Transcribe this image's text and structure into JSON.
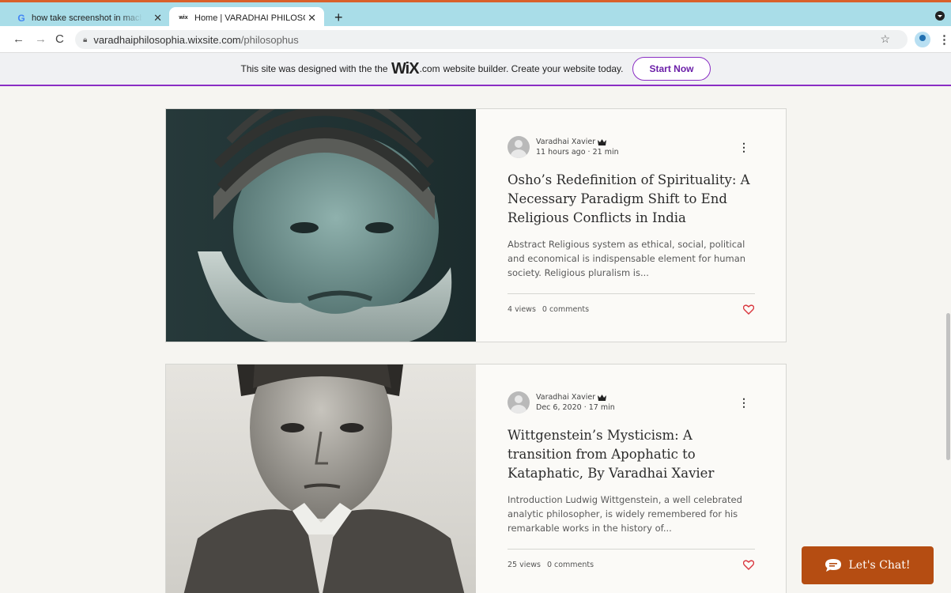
{
  "browser": {
    "tabs": [
      {
        "favicon": "G",
        "title": "how take screenshot in macbook",
        "close": "✕"
      },
      {
        "favicon": "wix",
        "title": "Home | VARADHAI PHILOSOPHY",
        "close": "✕"
      }
    ],
    "new_tab": "+",
    "url_domain": "varadhaiphilosophia.wixsite.com",
    "url_path": "/philosophus"
  },
  "wix_banner": {
    "text_before": "This site was designed with the",
    "logo": "WiX",
    "logo_suffix": ".com",
    "text_after": "website builder. Create your website today.",
    "button": "Start Now"
  },
  "posts": [
    {
      "author": "Varadhai Xavier",
      "date": "11 hours ago",
      "read_time": "21 min",
      "title": "Osho’s Redefinition of Spirituality: A Necessary Paradigm Shift to End Religious Conflicts in India",
      "excerpt": "Abstract Religious system as ethical, social, political and economical is indispensable element for human society. Religious pluralism is...",
      "views": "4 views",
      "comments": "0 comments"
    },
    {
      "author": "Varadhai Xavier",
      "date": "Dec 6, 2020",
      "read_time": "17 min",
      "title": "Wittgenstein’s Mysticism: A transition from Apophatic to Kataphatic, By Varadhai Xavier",
      "excerpt": "Introduction Ludwig Wittgenstein, a well celebrated analytic philosopher, is widely remembered for his remarkable works in the history of...",
      "views": "25 views",
      "comments": "0 comments"
    }
  ],
  "meta_separator": "·",
  "chat": {
    "label": "Let's Chat!"
  },
  "colors": {
    "tab_strip": "#a9dde8",
    "accent_purple": "#8a2ec4",
    "heart_red": "#d9363e",
    "chat_orange": "#b54d12"
  },
  "icons": [
    "google-favicon",
    "wix-favicon",
    "back-arrow-icon",
    "forward-arrow-icon",
    "reload-icon",
    "lock-icon",
    "star-icon",
    "profile-icon",
    "kebab-menu-icon",
    "crown-icon",
    "heart-icon",
    "chat-bubble-icon"
  ]
}
